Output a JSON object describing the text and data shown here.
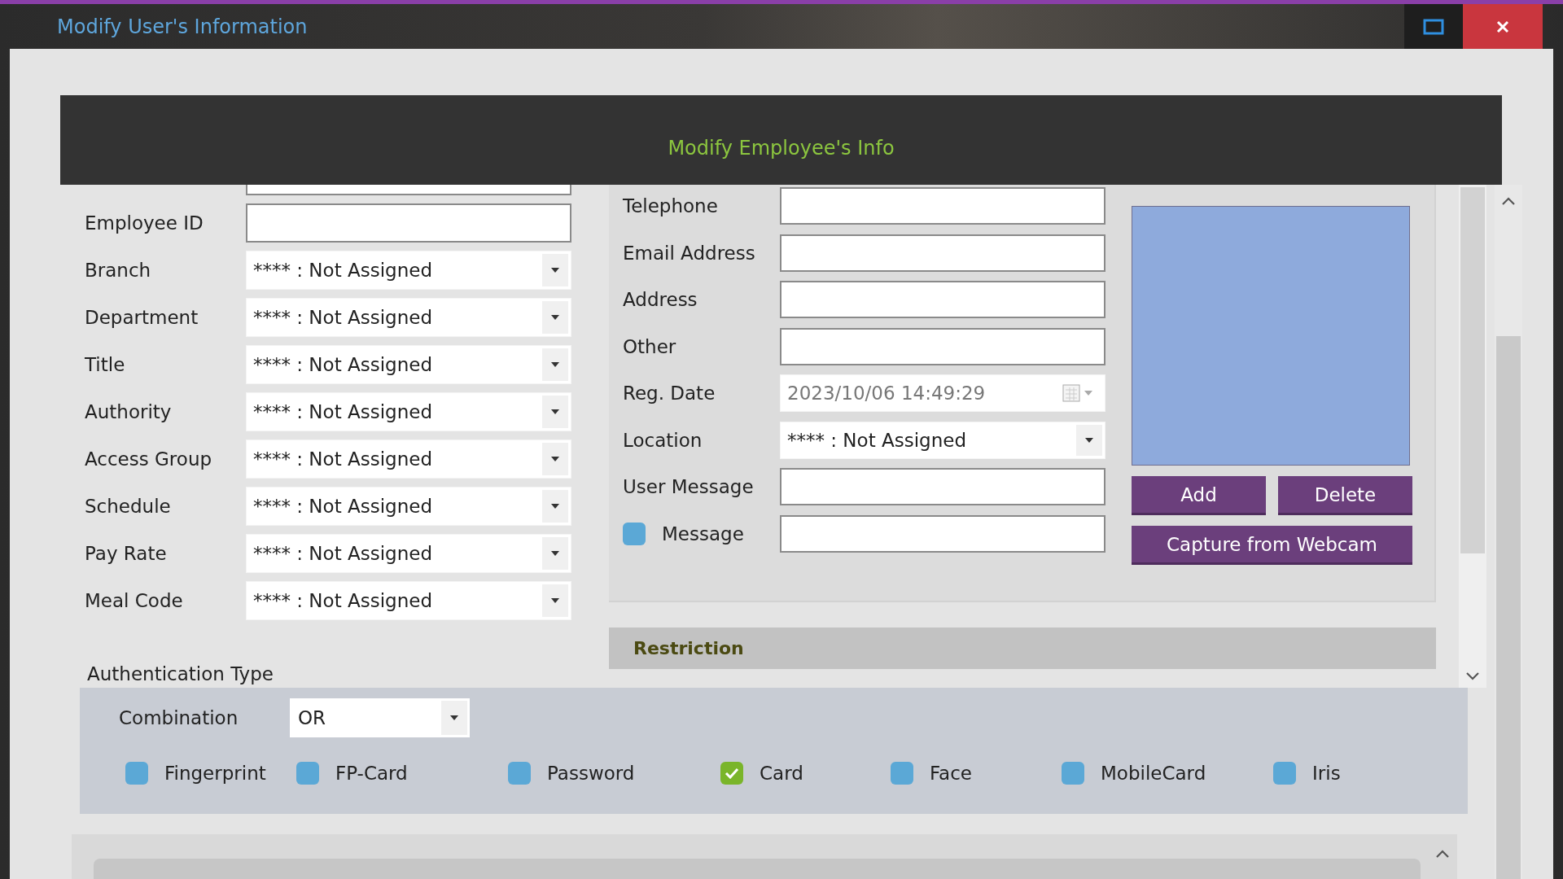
{
  "window": {
    "title": "Modify User's Information"
  },
  "header": {
    "title": "Modify Employee's Info"
  },
  "left_fields": [
    {
      "label": "Employee ID",
      "kind": "text"
    },
    {
      "label": "Branch",
      "kind": "select",
      "value": "**** : Not Assigned"
    },
    {
      "label": "Department",
      "kind": "select",
      "value": "**** : Not Assigned"
    },
    {
      "label": "Title",
      "kind": "select",
      "value": "**** : Not Assigned"
    },
    {
      "label": "Authority",
      "kind": "select",
      "value": "**** : Not Assigned"
    },
    {
      "label": "Access Group",
      "kind": "select",
      "value": "**** : Not Assigned"
    },
    {
      "label": "Schedule",
      "kind": "select",
      "value": "**** : Not Assigned"
    },
    {
      "label": "Pay Rate",
      "kind": "select",
      "value": "**** : Not Assigned"
    },
    {
      "label": "Meal Code",
      "kind": "select",
      "value": "**** : Not Assigned"
    }
  ],
  "right_fields": [
    {
      "label": "Telephone",
      "kind": "text"
    },
    {
      "label": "Email Address",
      "kind": "text"
    },
    {
      "label": "Address",
      "kind": "text"
    },
    {
      "label": "Other",
      "kind": "text"
    },
    {
      "label": "Reg. Date",
      "kind": "date",
      "value": "2023/10/06 14:49:29"
    },
    {
      "label": "Location",
      "kind": "select",
      "value": "**** : Not Assigned"
    },
    {
      "label": "User Message",
      "kind": "text"
    },
    {
      "label": "Message",
      "kind": "check",
      "checked": false
    }
  ],
  "picture": {
    "buttons": [
      "Add",
      "Delete"
    ],
    "capture_button": "Capture from Webcam"
  },
  "restriction": {
    "title": "Restriction"
  },
  "authentication": {
    "title": "Authentication Type",
    "combination_label": "Combination",
    "combination_value": "OR",
    "methods": [
      {
        "label": "Fingerprint",
        "checked": false
      },
      {
        "label": "FP-Card",
        "checked": false
      },
      {
        "label": "Password",
        "checked": false
      },
      {
        "label": "Card",
        "checked": true
      },
      {
        "label": "Face",
        "checked": false
      },
      {
        "label": "MobileCard",
        "checked": false
      },
      {
        "label": "Iris",
        "checked": false
      }
    ]
  }
}
